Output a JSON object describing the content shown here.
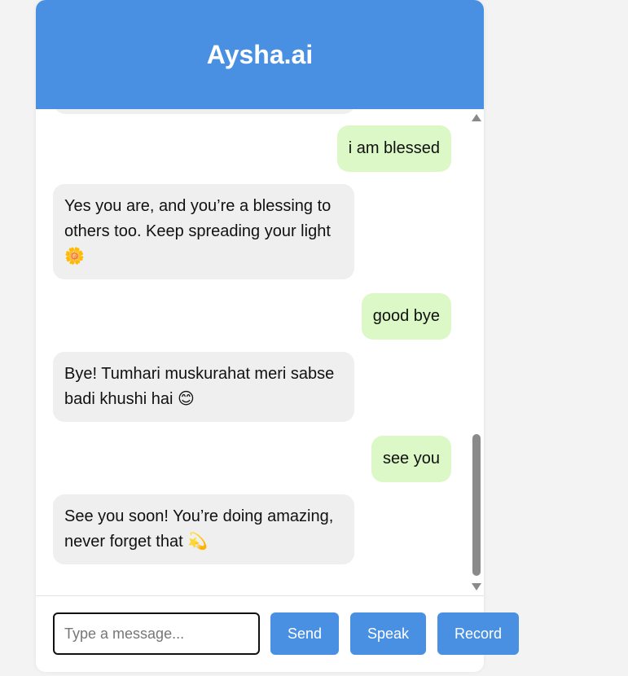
{
  "header": {
    "title": "Aysha.ai"
  },
  "messages": [
    {
      "sender": "user",
      "text": "i am blessed"
    },
    {
      "sender": "bot",
      "text": "Yes you are, and you’re a blessing to others too. Keep spreading your light 🌼"
    },
    {
      "sender": "user",
      "text": "good bye"
    },
    {
      "sender": "bot",
      "text": "Bye! Tumhari muskurahat meri sabse badi khushi hai 😊"
    },
    {
      "sender": "user",
      "text": "see you"
    },
    {
      "sender": "bot",
      "text": "See you soon! You’re doing amazing, never forget that 💫"
    }
  ],
  "input": {
    "placeholder": "Type a message...",
    "value": ""
  },
  "buttons": {
    "send": "Send",
    "speak": "Speak",
    "record": "Record"
  },
  "colors": {
    "accent": "#4a90e2",
    "user_bubble": "#dcf8c6",
    "bot_bubble": "#efefef"
  },
  "icons": {
    "scroll_up": "triangle-up",
    "scroll_down": "triangle-down"
  }
}
